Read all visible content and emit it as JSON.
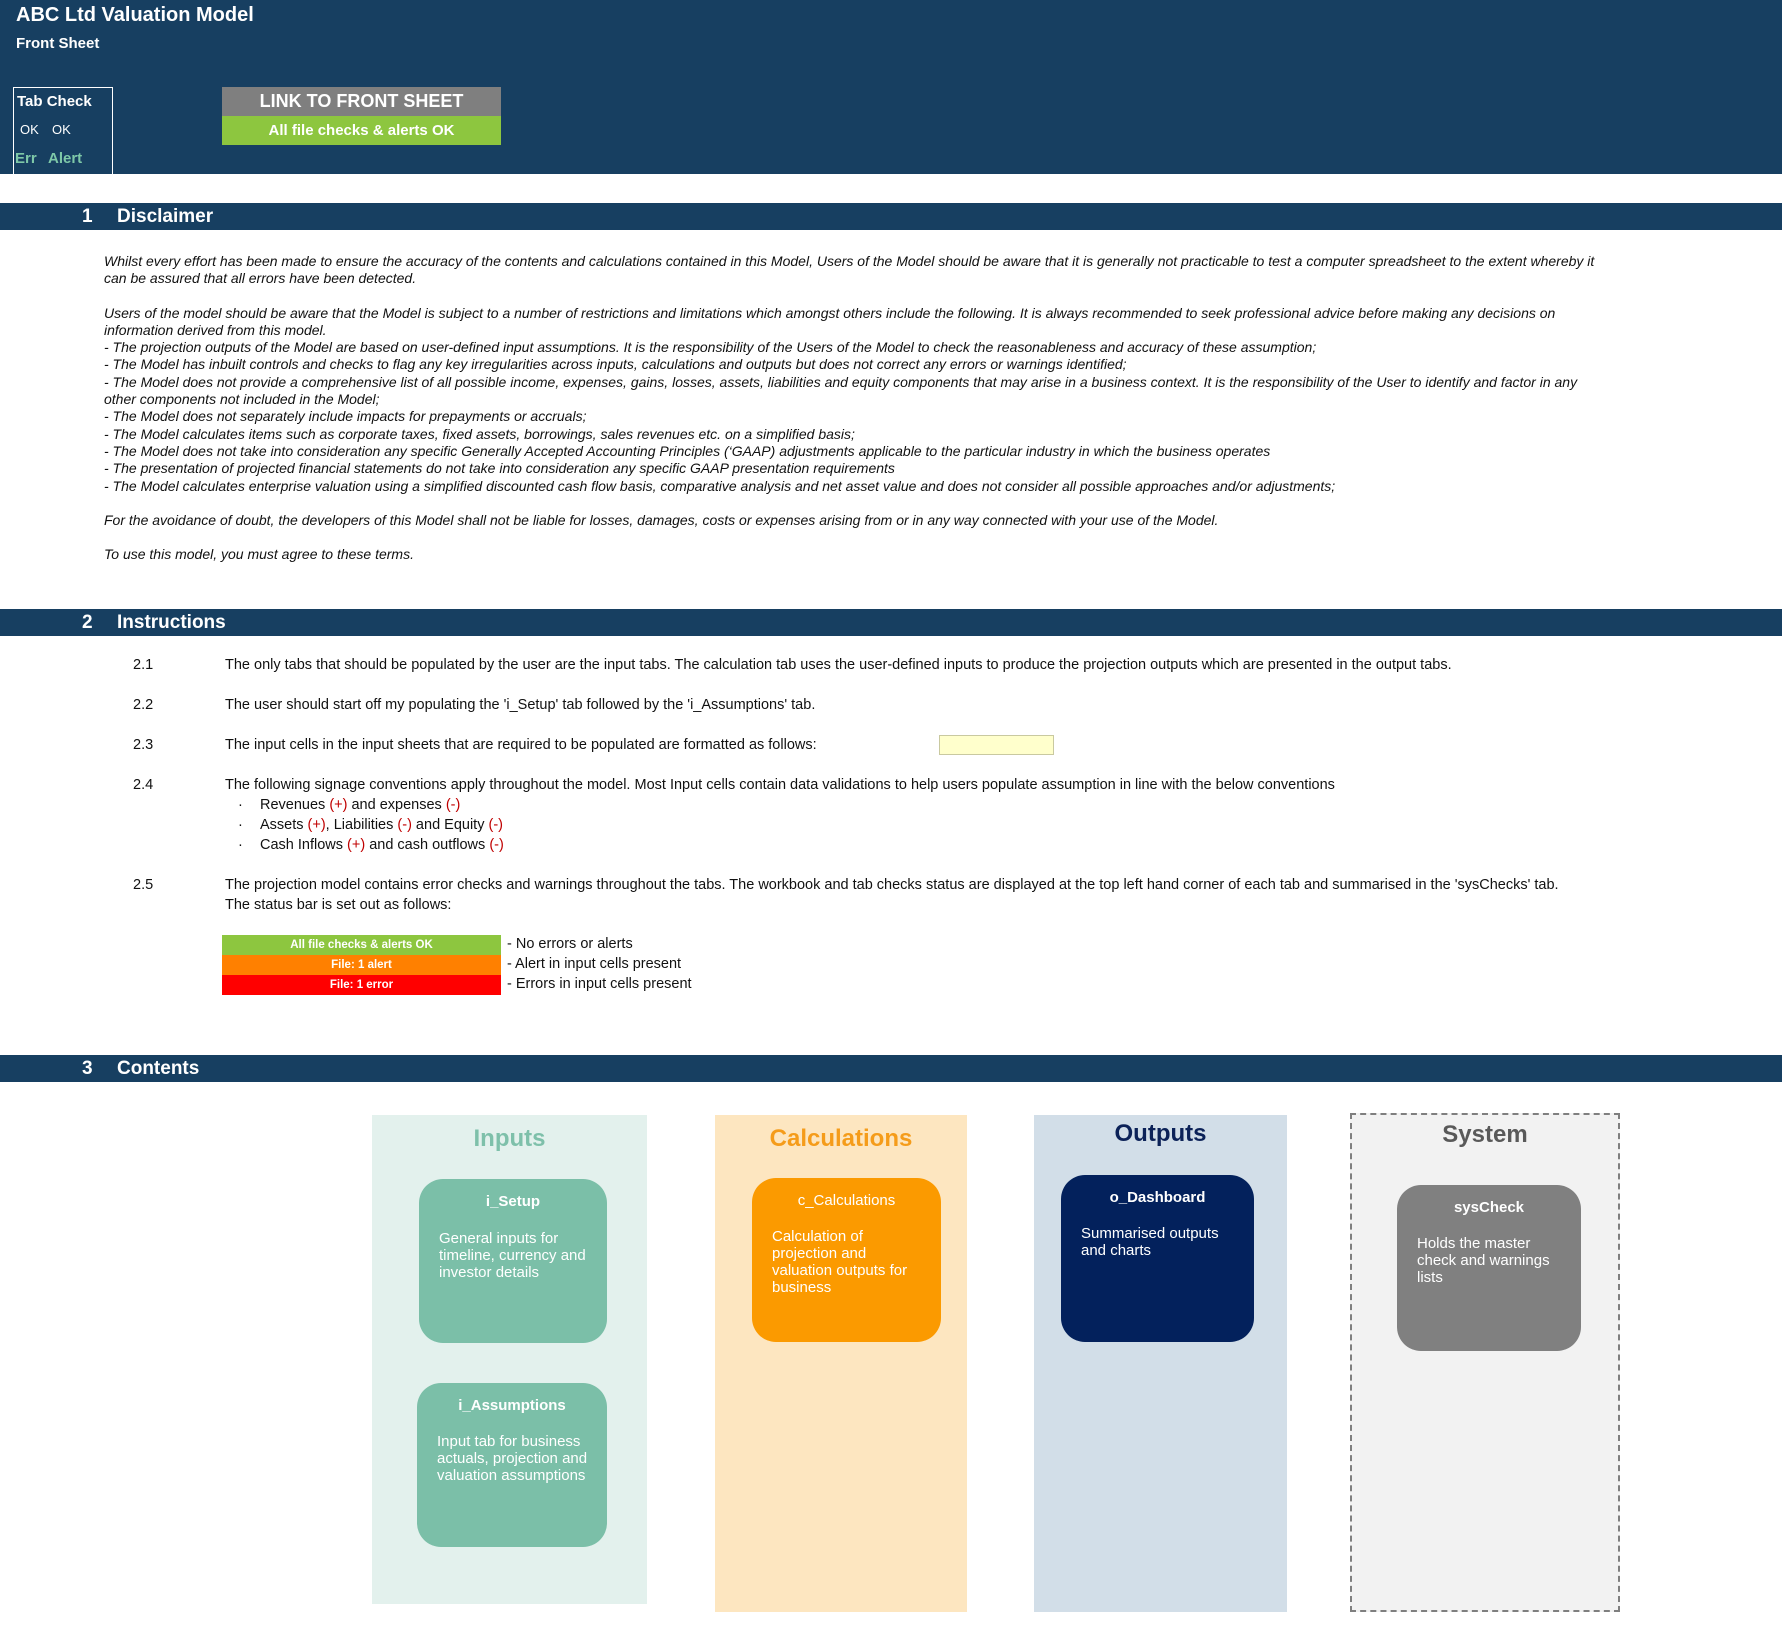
{
  "header": {
    "title": "ABC Ltd Valuation Model",
    "subtitle": "Front Sheet",
    "tab_check": {
      "label": "Tab Check",
      "ok_1": "OK",
      "ok_2": "OK",
      "err": "Err",
      "alert": "Alert"
    },
    "link_button": "LINK TO FRONT SHEET",
    "status": "All file checks & alerts OK"
  },
  "colors": {
    "header_bg": "#173f61",
    "ok_green": "#8dc63f",
    "alert_orange": "#ff8000",
    "error_red": "#ff0000",
    "input_yellow": "#ffffcc"
  },
  "sections": {
    "disclaimer": {
      "num": "1",
      "label": "Disclaimer"
    },
    "instructions": {
      "num": "2",
      "label": "Instructions"
    },
    "contents": {
      "num": "3",
      "label": "Contents"
    }
  },
  "disclaimer": {
    "p1": "Whilst every effort has been made to ensure the accuracy of the contents and calculations contained in this Model, Users of the Model should be aware that it is generally not practicable to test a computer spreadsheet to the extent whereby it can be assured that all errors have been detected.",
    "p2": "Users of the model should be aware that the Model is subject to a number of restrictions and limitations which amongst others include the following. It is always recommended to seek professional advice before making any decisions on information derived from this model.",
    "bullets": [
      "- The projection outputs of the Model are based on user-defined input assumptions. It is the responsibility of the Users of the Model to check the reasonableness and accuracy of these assumption;",
      "- The Model has inbuilt controls and checks to flag any key irregularities across inputs, calculations and outputs but does not correct any errors or warnings identified;",
      "- The Model does not provide a comprehensive list of all possible income, expenses, gains, losses, assets, liabilities and equity components that may arise in a business context. It is the responsibility of the User to identify and factor in any other components not included in the Model;",
      "- The Model does not separately include impacts for prepayments or accruals;",
      "- The Model calculates items such as corporate taxes, fixed assets, borrowings, sales revenues etc. on a simplified basis;",
      "- The Model does not take into consideration any specific Generally Accepted Accounting Principles (‘GAAP) adjustments applicable to the particular industry in which the business operates",
      "- The presentation of projected financial statements do not take into consideration any specific GAAP presentation requirements",
      "- The Model calculates enterprise valuation using a simplified discounted cash flow basis, comparative analysis and net asset value and does not consider all possible approaches and/or adjustments;"
    ],
    "p3": "For the avoidance of doubt, the developers of this Model shall not be liable for losses, damages, costs or expenses arising from or in any way connected with your use of the Model.",
    "p4": "To use this model, you must agree to these terms."
  },
  "instructions": {
    "items": [
      {
        "num": "2.1",
        "text": "The only tabs that should be populated by the user are the input tabs. The calculation tab uses the user-defined inputs to produce the projection outputs which are presented in the output tabs."
      },
      {
        "num": "2.2",
        "text": "The user should start off my populating the 'i_Setup' tab followed by the 'i_Assumptions' tab."
      },
      {
        "num": "2.3",
        "text": "The input cells in the input sheets that are required to be populated are formatted as follows:"
      },
      {
        "num": "2.4",
        "text": "The following signage conventions apply throughout the model. Most Input cells contain data validations to help users populate assumption in line with the below conventions"
      },
      {
        "num": "2.5",
        "text": "The projection model contains error checks and warnings throughout the tabs. The workbook and tab checks status are displayed at the top left hand corner of each tab and summarised in the 'sysChecks' tab.",
        "text2": "The status bar is set out as follows:"
      }
    ],
    "bullet_glyph": "·",
    "conventions": {
      "c1": {
        "a": "Revenues ",
        "b": "(+)",
        "c": " and expenses ",
        "d": "(-)"
      },
      "c2": {
        "a": "Assets ",
        "b": "(+)",
        "c": ", Liabilities ",
        "d": "(-)",
        "e": " and Equity ",
        "f": "(-)"
      },
      "c3": {
        "a": "Cash Inflows ",
        "b": "(+)",
        "c": " and cash outflows ",
        "d": "(-)"
      }
    },
    "legend": [
      {
        "bar": "All file checks & alerts OK",
        "desc": "- No errors or alerts"
      },
      {
        "bar": "File: 1 alert",
        "desc": "- Alert in input cells present"
      },
      {
        "bar": "File: 1 error",
        "desc": "- Errors in input cells present"
      }
    ]
  },
  "contents": {
    "inputs": {
      "title": "Inputs",
      "cards": [
        {
          "title": "i_Setup",
          "desc": "General inputs for timeline, currency and investor details"
        },
        {
          "title": "i_Assumptions",
          "desc": "Input tab for business actuals, projection and valuation assumptions"
        }
      ]
    },
    "calculations": {
      "title": "Calculations",
      "cards": [
        {
          "title": "c_Calculations",
          "desc": "Calculation of projection and valuation outputs for business"
        }
      ]
    },
    "outputs": {
      "title": "Outputs",
      "cards": [
        {
          "title": "o_Dashboard",
          "desc": "Summarised outputs and charts"
        }
      ]
    },
    "system": {
      "title": "System",
      "cards": [
        {
          "title": "sysCheck",
          "desc": "Holds the master check and warnings lists"
        }
      ]
    }
  }
}
